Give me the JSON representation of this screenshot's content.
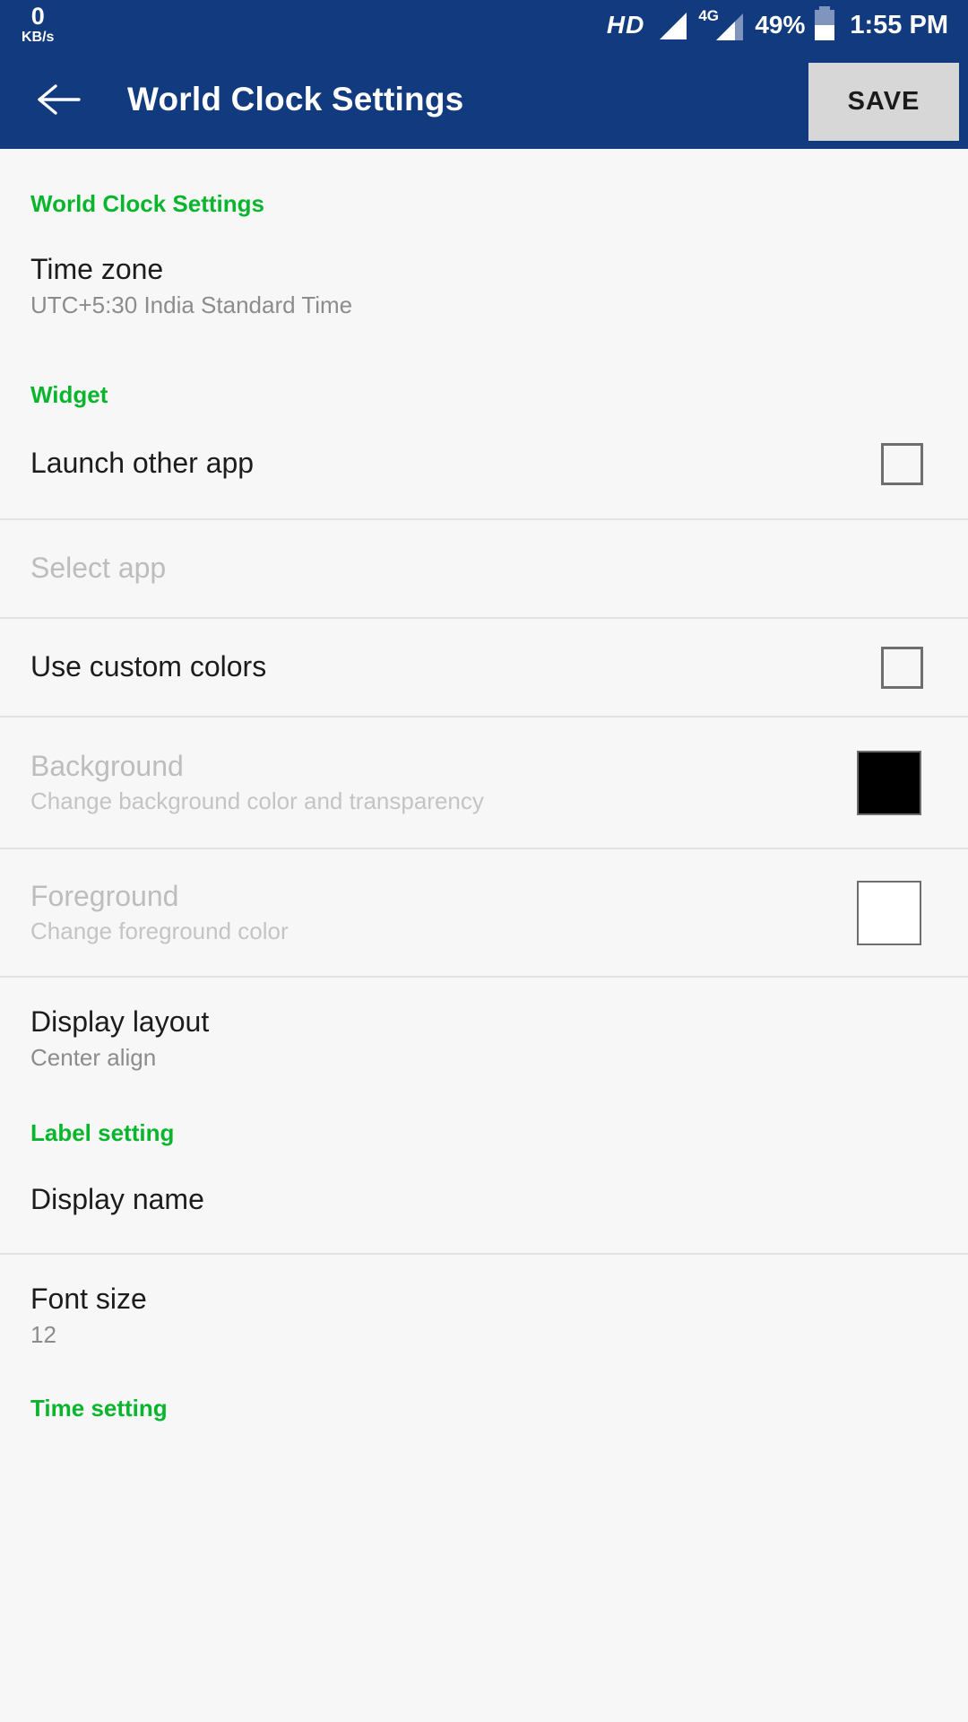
{
  "statusbar": {
    "net_speed_value": "0",
    "net_speed_unit": "KB/s",
    "hd_label": "HD",
    "network_type": "4G",
    "battery_percent": "49%",
    "time": "1:55 PM"
  },
  "appbar": {
    "back_icon": "arrow-left-icon",
    "title": "World Clock Settings",
    "save_label": "SAVE"
  },
  "sections": {
    "world_clock": "World Clock Settings",
    "widget": "Widget",
    "label_setting": "Label setting",
    "time_setting": "Time setting"
  },
  "rows": {
    "time_zone": {
      "title": "Time zone",
      "subtitle": "UTC+5:30 India Standard Time"
    },
    "launch_other_app": {
      "title": "Launch other app",
      "checked": false
    },
    "select_app": {
      "title": "Select app"
    },
    "use_custom_colors": {
      "title": "Use custom colors",
      "checked": false
    },
    "background": {
      "title": "Background",
      "subtitle": "Change background color and transparency",
      "swatch_color": "#000000"
    },
    "foreground": {
      "title": "Foreground",
      "subtitle": "Change foreground color",
      "swatch_color": "#ffffff"
    },
    "display_layout": {
      "title": "Display layout",
      "subtitle": "Center align"
    },
    "display_name": {
      "title": "Display name"
    },
    "font_size": {
      "title": "Font size",
      "subtitle": "12"
    }
  },
  "colors": {
    "primary": "#123a7e",
    "accent_green": "#0ab52e",
    "page_bg": "#f7f7f7",
    "divider": "#e3e3e3"
  }
}
